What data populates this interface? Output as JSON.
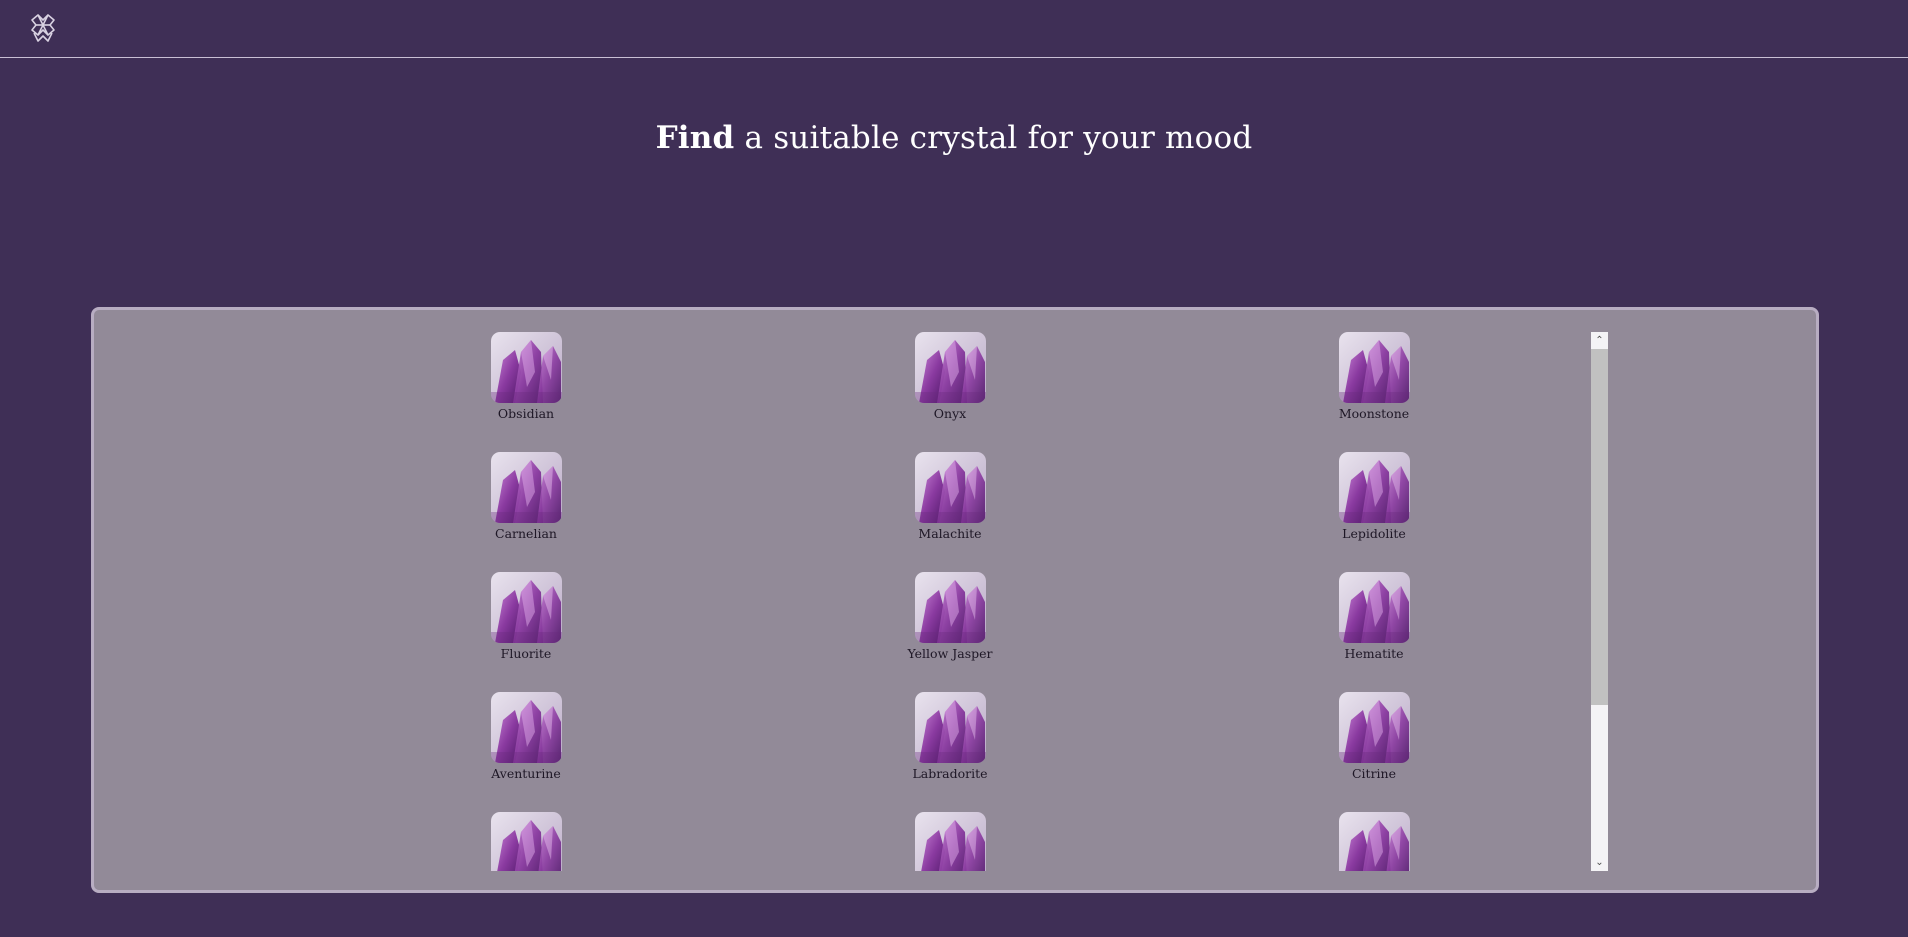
{
  "header": {
    "logo_icon": "crystal-logo-icon"
  },
  "hero": {
    "title_strong": "Find",
    "title_rest": " a suitable crystal for your mood"
  },
  "crystals": [
    [
      "Obsidian",
      "Onyx",
      "Moonstone"
    ],
    [
      "Carnelian",
      "Malachite",
      "Lepidolite"
    ],
    [
      "Fluorite",
      "Yellow Jasper",
      "Hematite"
    ],
    [
      "Aventurine",
      "Labradorite",
      "Citrine"
    ],
    [
      "",
      "",
      ""
    ]
  ],
  "scrollbar": {
    "up_icon": "chevron-up-icon",
    "down_icon": "chevron-down-icon",
    "up_glyph": "⌃",
    "down_glyph": "⌄"
  },
  "colors": {
    "background": "#3f2f56",
    "panel": "#928a98",
    "panel_border": "#b8adc2"
  }
}
